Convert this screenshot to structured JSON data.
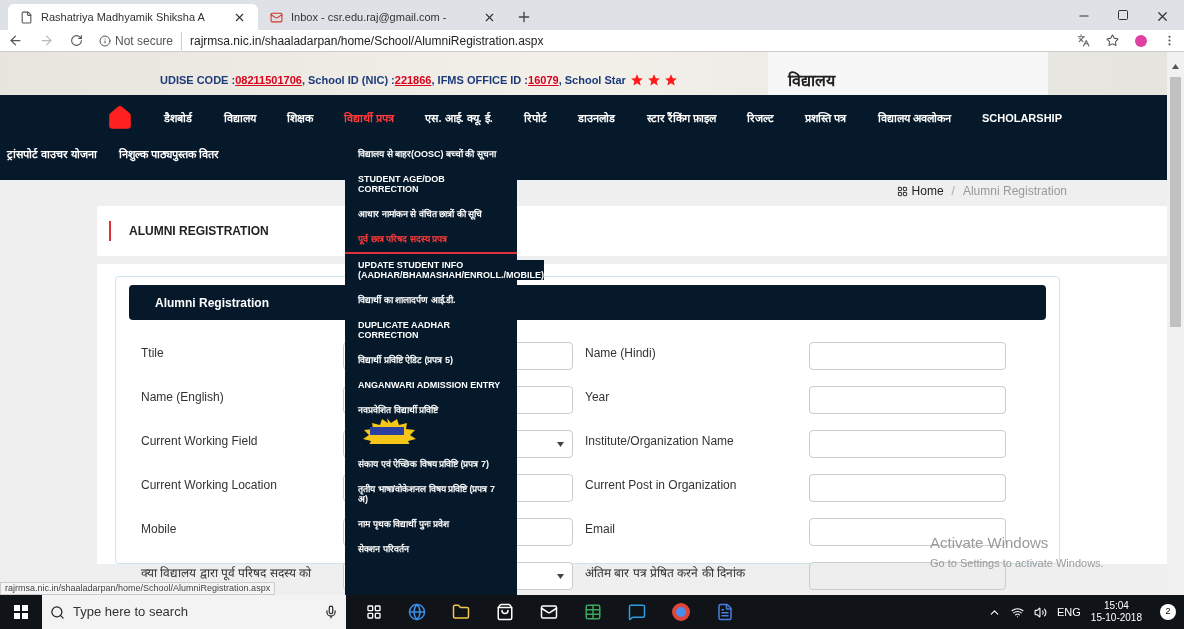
{
  "browser": {
    "tabs": [
      {
        "title": "Rashatriya Madhyamik Shiksha A",
        "selected": true,
        "kind": "page"
      },
      {
        "title": "Inbox - csr.edu.raj@gmail.com -",
        "selected": false,
        "kind": "mail"
      }
    ],
    "security": "Not secure",
    "url": "rajrmsa.nic.in/shaaladarpan/home/School/AlumniRegistration.aspx"
  },
  "header": {
    "info": [
      {
        "label": "UDISE CODE : ",
        "value": "08211501706"
      },
      {
        "label": ", School ID (NIC) : ",
        "value": "221866"
      },
      {
        "label": ", IFMS OFFICE ID : ",
        "value": "16079"
      }
    ],
    "star_label": ", School Star",
    "stars": 3,
    "logo_text": "विद्यालय"
  },
  "nav": {
    "primary": [
      {
        "label": "डैशबोर्ड",
        "selected": false
      },
      {
        "label": "विद्यालय",
        "selected": false
      },
      {
        "label": "शिक्षक",
        "selected": false
      },
      {
        "label": "विद्यार्थी प्रपत्र",
        "selected": true
      },
      {
        "label": "एस. आई. क्यू. ई.",
        "selected": false
      },
      {
        "label": "रिपोर्ट",
        "selected": false
      },
      {
        "label": "डाउनलोड",
        "selected": false
      },
      {
        "label": "स्टार रैंकिंग फ़ाइल",
        "selected": false
      },
      {
        "label": "रिजल्ट",
        "selected": false
      },
      {
        "label": "प्रशस्ति पत्र",
        "selected": false
      },
      {
        "label": "विद्यालय अवलोकन",
        "selected": false
      },
      {
        "label": "SCHOLARSHIP",
        "selected": false
      }
    ],
    "secondary": [
      {
        "label": "ट्रांसपोर्ट वाउचर योजना",
        "selected": false
      },
      {
        "label": "निशुल्क पाठ्यपुस्तक वितर",
        "selected": false
      }
    ]
  },
  "dropdown": [
    {
      "label": "विद्यालय से बाहर(OOSC) बच्चों की सूचना",
      "selected": false,
      "kind": "text"
    },
    {
      "label": "STUDENT AGE/DOB CORRECTION",
      "selected": false,
      "kind": "text"
    },
    {
      "label": "आधार नामांकन से वंचित छात्रों की सूचि",
      "selected": false,
      "kind": "text"
    },
    {
      "label": "पूर्व छात्र परिषद सदस्य प्रपत्र",
      "selected": true,
      "kind": "text"
    },
    {
      "label": "UPDATE STUDENT INFO (AADHAR/BHAMASHAH/ENROLL./MOBILE)",
      "selected": false,
      "kind": "text"
    },
    {
      "label": "विद्यार्थी का शालादर्पण आई.डी.",
      "selected": false,
      "kind": "text"
    },
    {
      "label": "DUPLICATE AADHAR CORRECTION",
      "selected": false,
      "kind": "text"
    },
    {
      "label": "विद्यार्थी प्रविष्टि ऐडिट (प्रपत्र 5)",
      "selected": false,
      "kind": "text"
    },
    {
      "label": "ANGANWARI ADMISSION ENTRY",
      "selected": false,
      "kind": "text"
    },
    {
      "label": "नवप्रवेशित विद्यार्थी प्रविष्टि",
      "selected": false,
      "kind": "badge"
    },
    {
      "label": "संकाय एवं ऐच्छिक विषय प्रविष्टि (प्रपत्र 7)",
      "selected": false,
      "kind": "text"
    },
    {
      "label": "तृतीय भाषा/वोकेशनल विषय प्रविष्टि (प्रपत्र 7 अ)",
      "selected": false,
      "kind": "text"
    },
    {
      "label": "नाम पृथक विद्यार्थी पुनः प्रवेश",
      "selected": false,
      "kind": "text"
    },
    {
      "label": "सेक्शन परिवर्तन",
      "selected": false,
      "kind": "text"
    }
  ],
  "breadcrumb": {
    "home": "Home",
    "separator": "/",
    "current": "Alumni Registration"
  },
  "page_title": "ALUMNI REGISTRATION",
  "form": {
    "title": "Alumni Registration",
    "rows": [
      [
        {
          "label": "Ttile",
          "kind": "input"
        },
        {
          "label": "Name (Hindi)",
          "kind": "input"
        }
      ],
      [
        {
          "label": "Name (English)",
          "kind": "input"
        },
        {
          "label": "Year",
          "kind": "input"
        }
      ],
      [
        {
          "label": "Current Working Field",
          "kind": "select"
        },
        {
          "label": "Institute/Organization Name",
          "kind": "input"
        }
      ],
      [
        {
          "label": "Current Working Location",
          "kind": "input"
        },
        {
          "label": "Current Post in Organization",
          "kind": "input"
        }
      ],
      [
        {
          "label": "Mobile",
          "kind": "input"
        },
        {
          "label": "Email",
          "kind": "input"
        }
      ],
      [
        {
          "label": "क्या विद्यालय द्वारा पूर्व परिषद सदस्य को",
          "kind": "select"
        },
        {
          "label": "अंतिम बार पत्र प्रेषित करने की दिनांक",
          "kind": "disabled"
        }
      ]
    ]
  },
  "status_link": "rajrmsa.nic.in/shaaladarpan/home/School/AlumniRegistration.aspx",
  "activation": {
    "title": "Activate Windows",
    "hint": "Go to Settings to activate Windows."
  },
  "taskbar": {
    "search": "Type here to search",
    "language": "ENG",
    "time": "15:04",
    "date": "15-10-2018",
    "notifications": "2"
  }
}
